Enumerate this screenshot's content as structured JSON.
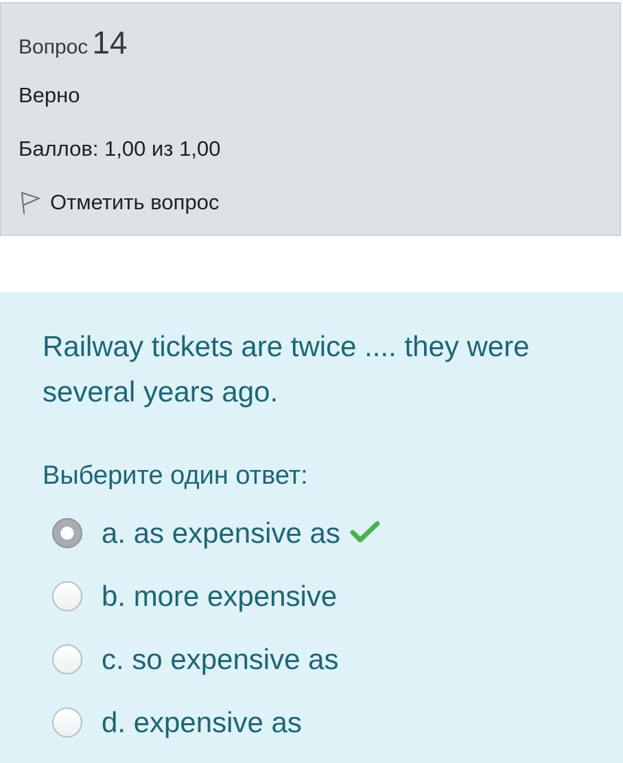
{
  "info": {
    "question_word": "Вопрос",
    "question_number": "14",
    "status": "Верно",
    "grade": "Баллов: 1,00 из 1,00",
    "flag_label": "Отметить вопрос",
    "flag_icon": "flag-icon"
  },
  "question": {
    "text": "Railway tickets are twice .... they were several years ago.",
    "prompt": "Выберите один ответ:",
    "answers": [
      {
        "label": "a. as expensive as",
        "selected": true,
        "correct": true
      },
      {
        "label": "b. more expensive",
        "selected": false
      },
      {
        "label": "c. so expensive as",
        "selected": false
      },
      {
        "label": "d. expensive as",
        "selected": false
      }
    ],
    "correct_icon": "checkmark-icon"
  },
  "colors": {
    "info_bg": "#dee2e6",
    "question_bg": "#def2f8",
    "question_text": "#1e6575",
    "correct_green": "#4caf50"
  }
}
